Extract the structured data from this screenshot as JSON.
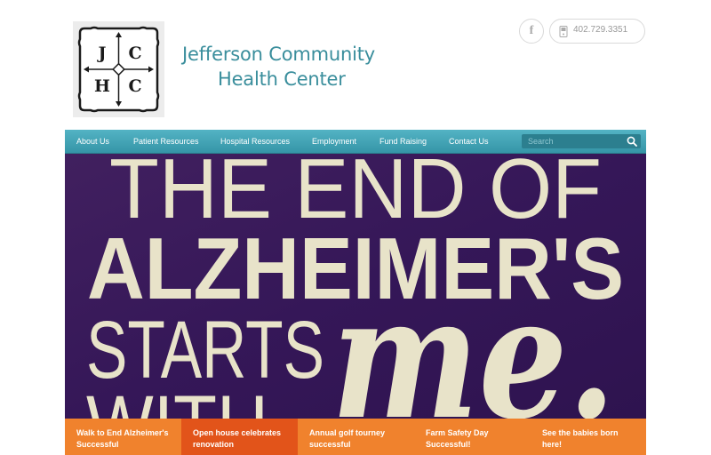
{
  "header": {
    "logo_letters": [
      "J",
      "C",
      "H",
      "C"
    ],
    "org_name_line1": "Jefferson Community",
    "org_name_line2": "Health Center",
    "facebook_icon": "facebook-icon",
    "phone_icon": "phone-icon",
    "phone": "402.729.3351"
  },
  "nav": {
    "items": [
      "About Us",
      "Patient Resources",
      "Hospital Resources",
      "Employment",
      "Fund Raising",
      "Contact Us"
    ],
    "search_placeholder": "Search",
    "search_icon": "search-icon"
  },
  "hero": {
    "line1": "THE END OF",
    "line2": "ALZHEIMER'S",
    "line3": "STARTS",
    "line4": "WITH",
    "script_word": "me."
  },
  "slider_tabs": [
    {
      "line1": "Walk to End Alzheimer's",
      "line2": "Successful",
      "active": false
    },
    {
      "line1": "Open house celebrates",
      "line2": "renovation",
      "active": true
    },
    {
      "line1": "Annual golf tourney",
      "line2": "successful",
      "active": false
    },
    {
      "line1": "Farm Safety Day",
      "line2": "Successful!",
      "active": false
    },
    {
      "line1": "See the babies born",
      "line2": "here!",
      "active": false
    }
  ],
  "colors": {
    "brand_teal": "#3a8e9c",
    "nav_teal": "#3fa0b2",
    "tab_orange": "#f0822d",
    "tab_active": "#e2541a",
    "hero_purple": "#3b1a5e"
  }
}
